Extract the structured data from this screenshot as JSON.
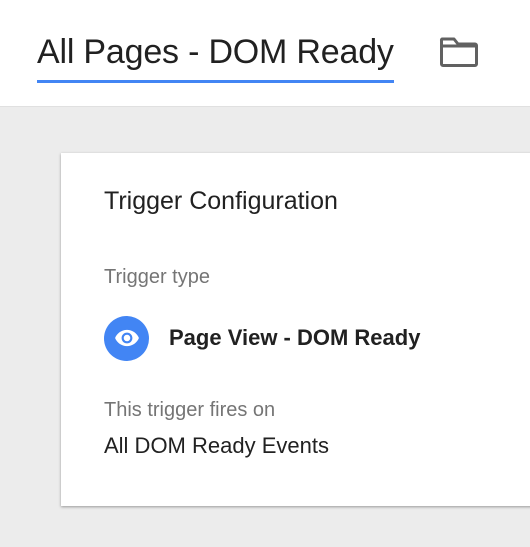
{
  "header": {
    "trigger_name": "All Pages - DOM Ready",
    "folder_icon": "folder-icon"
  },
  "card": {
    "title": "Trigger Configuration",
    "trigger_type_label": "Trigger type",
    "trigger_type_icon": "eye-icon",
    "trigger_type_value": "Page View - DOM Ready",
    "fires_on_label": "This trigger fires on",
    "fires_on_value": "All DOM Ready Events"
  },
  "colors": {
    "accent": "#4285f4",
    "background": "#ececec",
    "text_primary": "#212121",
    "text_secondary": "#757575"
  }
}
